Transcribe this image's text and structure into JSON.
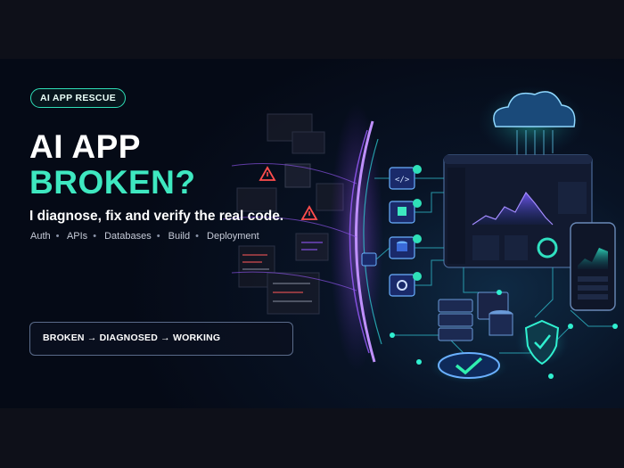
{
  "hero": {
    "badge": "AI APP RESCUE",
    "headline_line1": "AI APP",
    "headline_line2": "BROKEN?",
    "subheadline": "I diagnose, fix and verify the real code.",
    "topics": [
      "Auth",
      "APIs",
      "Databases",
      "Build",
      "Deployment"
    ],
    "flow": "BROKEN → DIAGNOSED → WORKING"
  },
  "colors": {
    "accent": "#3ee8c0",
    "background": "#0d0f1a",
    "warning": "#ff4d4d",
    "purple": "#9b5cff"
  },
  "icons": [
    "warning-icon",
    "code-icon",
    "puzzle-icon",
    "database-icon",
    "gear-icon",
    "check-icon",
    "cloud-icon",
    "shield-icon",
    "server-icon"
  ]
}
